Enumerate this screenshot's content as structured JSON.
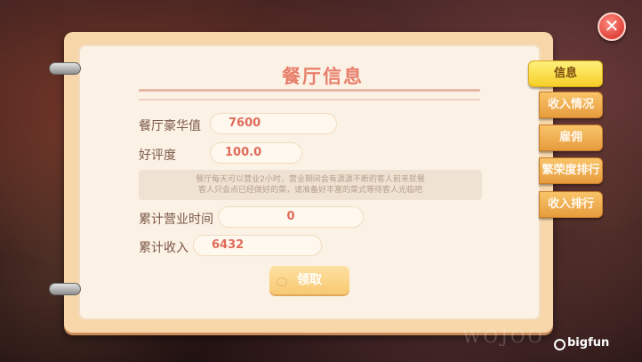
{
  "dialog": {
    "title": "餐厅信息",
    "close_glyph": "✕"
  },
  "stats": {
    "luxury_label": "餐厅豪华值",
    "luxury_value": "7600",
    "rating_label": "好评度",
    "rating_value": "100.0",
    "hours_label": "累计营业时间",
    "hours_value": "0",
    "income_label": "累计收入",
    "income_value": "6432"
  },
  "note": {
    "line1": "餐厅每天可以营业2小时，营业期间会有源源不断的客人前来就餐",
    "line2": "客人只会点已经做好的菜，请准备好丰富的菜式等待客人光临吧"
  },
  "actions": {
    "claim_label": "领取"
  },
  "tabs": [
    {
      "label": "信息",
      "active": true
    },
    {
      "label": "收入情况",
      "active": false
    },
    {
      "label": "雇佣",
      "active": false
    },
    {
      "label": "繁荣度排行",
      "active": false
    },
    {
      "label": "收入排行",
      "active": false
    }
  ],
  "watermark": {
    "brand": "bigfun"
  },
  "colors": {
    "accent_title": "#e87f6b",
    "active_tab": "#f6cf28",
    "tab": "#e69c3d",
    "value_text": "#e06b5a"
  }
}
